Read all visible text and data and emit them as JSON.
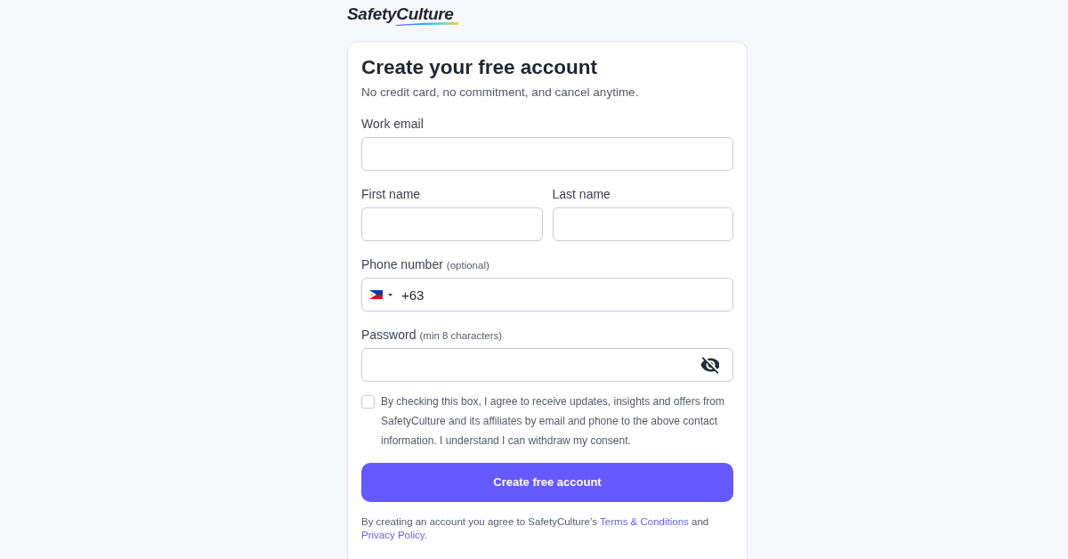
{
  "logo": {
    "text": "SafetyCulture"
  },
  "heading": {
    "title": "Create your free account",
    "subtitle": "No credit card, no commitment, and cancel anytime."
  },
  "form_rows": [
    [
      {
        "kind": "email",
        "label": "Work email"
      }
    ],
    [
      {
        "kind": "text",
        "label": "First name"
      },
      {
        "kind": "text",
        "label": "Last name"
      }
    ],
    [
      {
        "kind": "phone",
        "label": "Phone number",
        "hint": "(optional)",
        "value": "+63"
      }
    ],
    [
      {
        "kind": "password",
        "label": "Password",
        "hint": "(min 8 characters)"
      }
    ]
  ],
  "consent": {
    "checked": false,
    "text": "By checking this box, I agree to receive updates, insights and offers from SafetyCulture and its affiliates by email and phone to the above contact information. I understand I can withdraw my consent."
  },
  "submit_button": "Create free account",
  "legal": [
    {
      "kind": "text",
      "text": "By creating an account you agree to SafetyCulture’s"
    },
    {
      "kind": "link",
      "text": "Terms & Conditions"
    },
    {
      "kind": "text",
      "text": "and"
    },
    {
      "kind": "link",
      "text": "Privacy Policy."
    }
  ]
}
